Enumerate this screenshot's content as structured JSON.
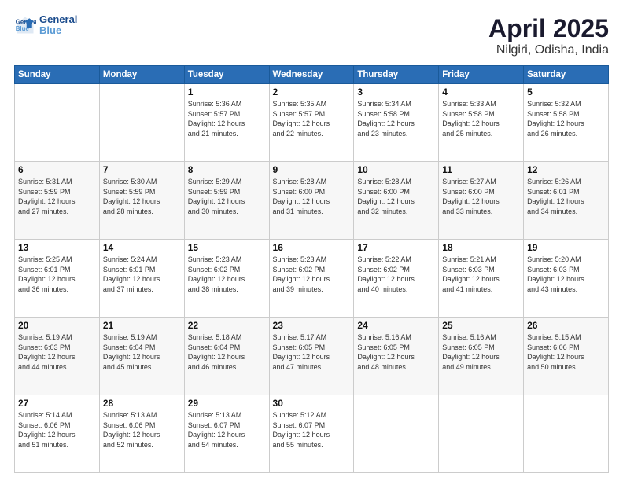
{
  "header": {
    "logo_line1": "General",
    "logo_line2": "Blue",
    "month": "April 2025",
    "location": "Nilgiri, Odisha, India"
  },
  "weekdays": [
    "Sunday",
    "Monday",
    "Tuesday",
    "Wednesday",
    "Thursday",
    "Friday",
    "Saturday"
  ],
  "weeks": [
    [
      {
        "day": "",
        "info": ""
      },
      {
        "day": "",
        "info": ""
      },
      {
        "day": "1",
        "info": "Sunrise: 5:36 AM\nSunset: 5:57 PM\nDaylight: 12 hours\nand 21 minutes."
      },
      {
        "day": "2",
        "info": "Sunrise: 5:35 AM\nSunset: 5:57 PM\nDaylight: 12 hours\nand 22 minutes."
      },
      {
        "day": "3",
        "info": "Sunrise: 5:34 AM\nSunset: 5:58 PM\nDaylight: 12 hours\nand 23 minutes."
      },
      {
        "day": "4",
        "info": "Sunrise: 5:33 AM\nSunset: 5:58 PM\nDaylight: 12 hours\nand 25 minutes."
      },
      {
        "day": "5",
        "info": "Sunrise: 5:32 AM\nSunset: 5:58 PM\nDaylight: 12 hours\nand 26 minutes."
      }
    ],
    [
      {
        "day": "6",
        "info": "Sunrise: 5:31 AM\nSunset: 5:59 PM\nDaylight: 12 hours\nand 27 minutes."
      },
      {
        "day": "7",
        "info": "Sunrise: 5:30 AM\nSunset: 5:59 PM\nDaylight: 12 hours\nand 28 minutes."
      },
      {
        "day": "8",
        "info": "Sunrise: 5:29 AM\nSunset: 5:59 PM\nDaylight: 12 hours\nand 30 minutes."
      },
      {
        "day": "9",
        "info": "Sunrise: 5:28 AM\nSunset: 6:00 PM\nDaylight: 12 hours\nand 31 minutes."
      },
      {
        "day": "10",
        "info": "Sunrise: 5:28 AM\nSunset: 6:00 PM\nDaylight: 12 hours\nand 32 minutes."
      },
      {
        "day": "11",
        "info": "Sunrise: 5:27 AM\nSunset: 6:00 PM\nDaylight: 12 hours\nand 33 minutes."
      },
      {
        "day": "12",
        "info": "Sunrise: 5:26 AM\nSunset: 6:01 PM\nDaylight: 12 hours\nand 34 minutes."
      }
    ],
    [
      {
        "day": "13",
        "info": "Sunrise: 5:25 AM\nSunset: 6:01 PM\nDaylight: 12 hours\nand 36 minutes."
      },
      {
        "day": "14",
        "info": "Sunrise: 5:24 AM\nSunset: 6:01 PM\nDaylight: 12 hours\nand 37 minutes."
      },
      {
        "day": "15",
        "info": "Sunrise: 5:23 AM\nSunset: 6:02 PM\nDaylight: 12 hours\nand 38 minutes."
      },
      {
        "day": "16",
        "info": "Sunrise: 5:23 AM\nSunset: 6:02 PM\nDaylight: 12 hours\nand 39 minutes."
      },
      {
        "day": "17",
        "info": "Sunrise: 5:22 AM\nSunset: 6:02 PM\nDaylight: 12 hours\nand 40 minutes."
      },
      {
        "day": "18",
        "info": "Sunrise: 5:21 AM\nSunset: 6:03 PM\nDaylight: 12 hours\nand 41 minutes."
      },
      {
        "day": "19",
        "info": "Sunrise: 5:20 AM\nSunset: 6:03 PM\nDaylight: 12 hours\nand 43 minutes."
      }
    ],
    [
      {
        "day": "20",
        "info": "Sunrise: 5:19 AM\nSunset: 6:03 PM\nDaylight: 12 hours\nand 44 minutes."
      },
      {
        "day": "21",
        "info": "Sunrise: 5:19 AM\nSunset: 6:04 PM\nDaylight: 12 hours\nand 45 minutes."
      },
      {
        "day": "22",
        "info": "Sunrise: 5:18 AM\nSunset: 6:04 PM\nDaylight: 12 hours\nand 46 minutes."
      },
      {
        "day": "23",
        "info": "Sunrise: 5:17 AM\nSunset: 6:05 PM\nDaylight: 12 hours\nand 47 minutes."
      },
      {
        "day": "24",
        "info": "Sunrise: 5:16 AM\nSunset: 6:05 PM\nDaylight: 12 hours\nand 48 minutes."
      },
      {
        "day": "25",
        "info": "Sunrise: 5:16 AM\nSunset: 6:05 PM\nDaylight: 12 hours\nand 49 minutes."
      },
      {
        "day": "26",
        "info": "Sunrise: 5:15 AM\nSunset: 6:06 PM\nDaylight: 12 hours\nand 50 minutes."
      }
    ],
    [
      {
        "day": "27",
        "info": "Sunrise: 5:14 AM\nSunset: 6:06 PM\nDaylight: 12 hours\nand 51 minutes."
      },
      {
        "day": "28",
        "info": "Sunrise: 5:13 AM\nSunset: 6:06 PM\nDaylight: 12 hours\nand 52 minutes."
      },
      {
        "day": "29",
        "info": "Sunrise: 5:13 AM\nSunset: 6:07 PM\nDaylight: 12 hours\nand 54 minutes."
      },
      {
        "day": "30",
        "info": "Sunrise: 5:12 AM\nSunset: 6:07 PM\nDaylight: 12 hours\nand 55 minutes."
      },
      {
        "day": "",
        "info": ""
      },
      {
        "day": "",
        "info": ""
      },
      {
        "day": "",
        "info": ""
      }
    ]
  ]
}
